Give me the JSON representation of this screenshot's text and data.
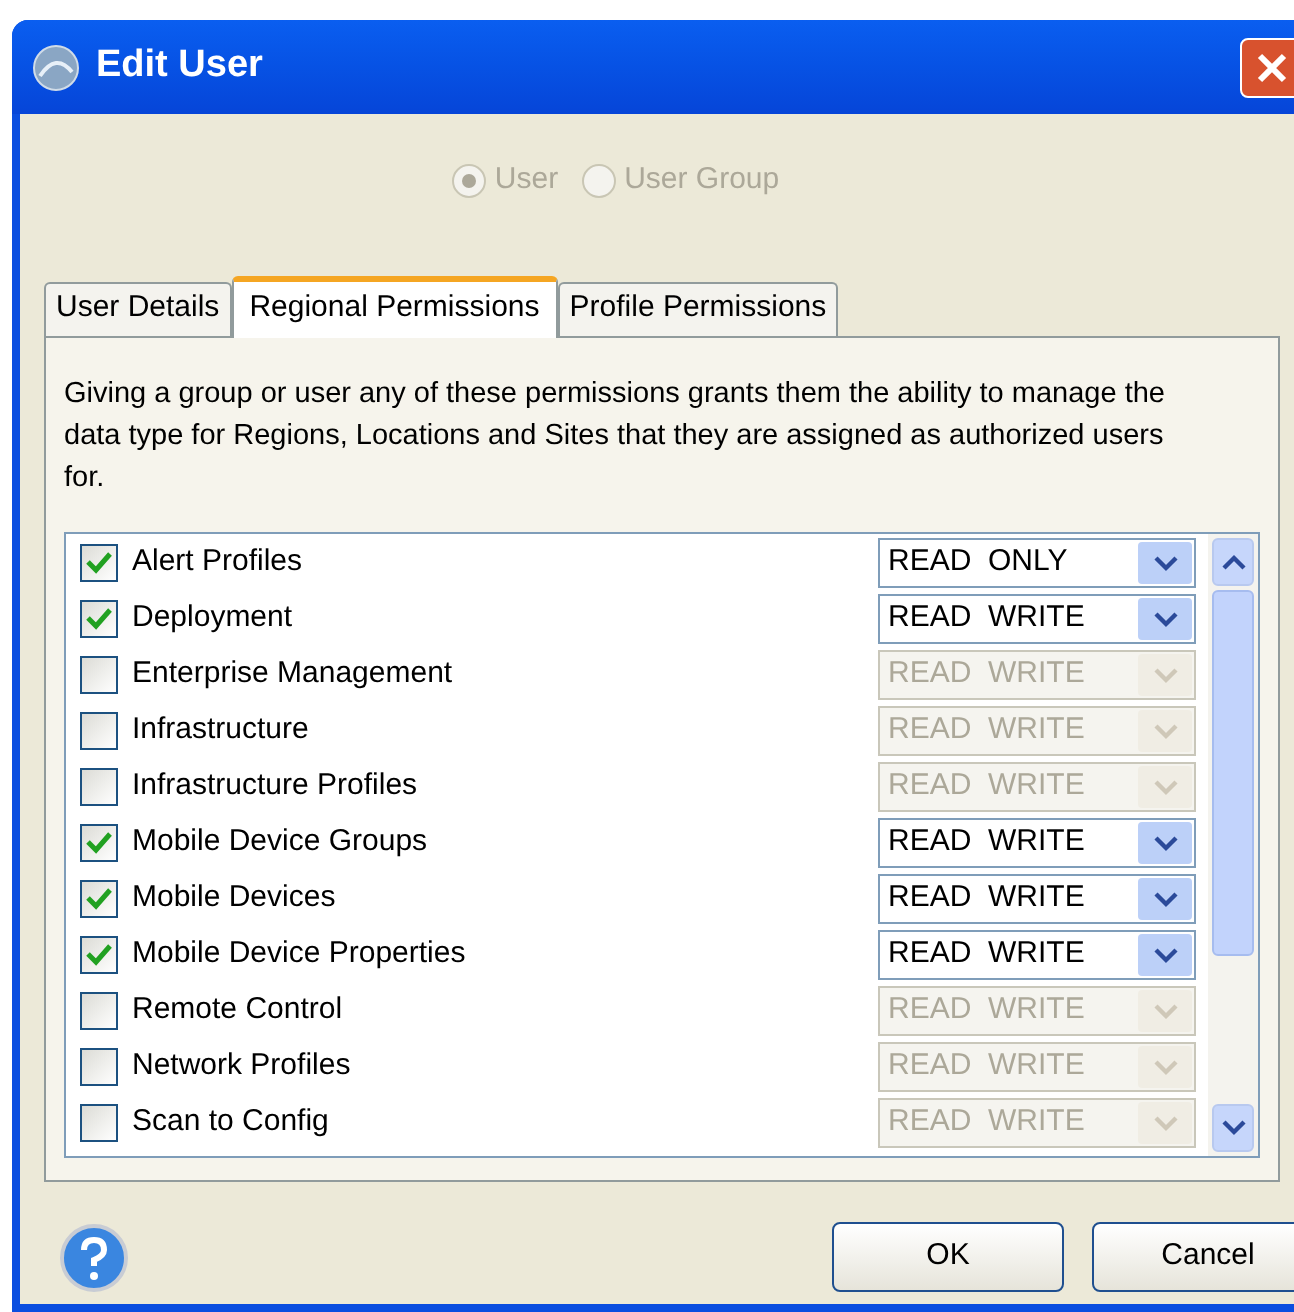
{
  "window": {
    "title": "Edit User"
  },
  "user_type": [
    {
      "label": "User",
      "selected": true,
      "disabled": true
    },
    {
      "label": "User Group",
      "selected": false,
      "disabled": true
    }
  ],
  "tabs": [
    {
      "label": "User Details",
      "selected": false
    },
    {
      "label": "Regional Permissions",
      "selected": true
    },
    {
      "label": "Profile Permissions",
      "selected": false
    }
  ],
  "description": "Giving a group or user any of these permissions grants them the ability to manage the data type for Regions, Locations and Sites that they are assigned as authorized users for.",
  "permissions": [
    {
      "label": "Alert Profiles",
      "checked": true,
      "access": "READ  ONLY"
    },
    {
      "label": "Deployment",
      "checked": true,
      "access": "READ  WRITE"
    },
    {
      "label": "Enterprise Management",
      "checked": false,
      "access": "READ  WRITE"
    },
    {
      "label": "Infrastructure",
      "checked": false,
      "access": "READ  WRITE"
    },
    {
      "label": "Infrastructure Profiles",
      "checked": false,
      "access": "READ  WRITE"
    },
    {
      "label": "Mobile Device Groups",
      "checked": true,
      "access": "READ  WRITE"
    },
    {
      "label": "Mobile Devices",
      "checked": true,
      "access": "READ  WRITE"
    },
    {
      "label": "Mobile Device Properties",
      "checked": true,
      "access": "READ  WRITE"
    },
    {
      "label": "Remote Control",
      "checked": false,
      "access": "READ  WRITE"
    },
    {
      "label": "Network Profiles",
      "checked": false,
      "access": "READ  WRITE"
    },
    {
      "label": "Scan to Config",
      "checked": false,
      "access": "READ  WRITE"
    }
  ],
  "buttons": [
    "OK",
    "Cancel"
  ]
}
